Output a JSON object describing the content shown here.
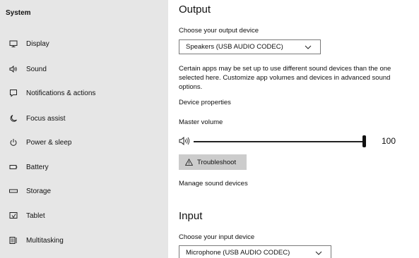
{
  "sidebar": {
    "title": "System",
    "items": [
      {
        "label": "Display",
        "icon": "monitor-icon"
      },
      {
        "label": "Sound",
        "icon": "speaker-icon"
      },
      {
        "label": "Notifications & actions",
        "icon": "notification-icon"
      },
      {
        "label": "Focus assist",
        "icon": "moon-icon"
      },
      {
        "label": "Power & sleep",
        "icon": "power-icon"
      },
      {
        "label": "Battery",
        "icon": "battery-icon"
      },
      {
        "label": "Storage",
        "icon": "storage-icon"
      },
      {
        "label": "Tablet",
        "icon": "tablet-icon"
      },
      {
        "label": "Multitasking",
        "icon": "multitasking-icon"
      }
    ]
  },
  "output": {
    "heading": "Output",
    "choose_label": "Choose your output device",
    "device": "Speakers (USB AUDIO  CODEC)",
    "description": "Certain apps may be set up to use different sound devices than the one selected here. Customize app volumes and devices in advanced sound options.",
    "device_properties_link": "Device properties",
    "master_volume_label": "Master volume",
    "volume_value": "100",
    "volume_level": 1.0,
    "troubleshoot_label": "Troubleshoot",
    "manage_devices_link": "Manage sound devices"
  },
  "input": {
    "heading": "Input",
    "choose_label": "Choose your input device",
    "device": "Microphone (USB AUDIO  CODEC)"
  }
}
